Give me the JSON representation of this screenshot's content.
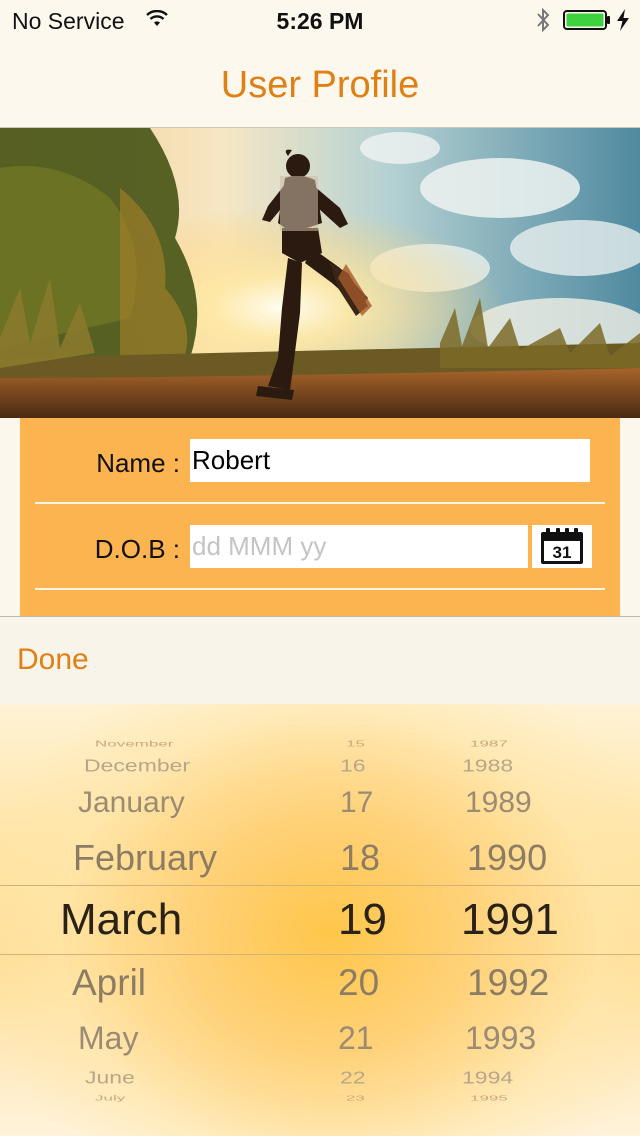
{
  "status_bar": {
    "carrier": "No Service",
    "time": "5:26 PM"
  },
  "nav": {
    "title": "User Profile"
  },
  "hero": {
    "description_icon": "runner-photo"
  },
  "form": {
    "name_label": "Name :",
    "name_value": "Robert",
    "dob_label": "D.O.B :",
    "dob_placeholder": "dd MMM yy",
    "calendar_icon_day": "31"
  },
  "toolbar": {
    "done_label": "Done"
  },
  "picker": {
    "months": [
      "November",
      "December",
      "January",
      "February",
      "March",
      "April",
      "May",
      "June",
      "July"
    ],
    "days": [
      "15",
      "16",
      "17",
      "18",
      "19",
      "20",
      "21",
      "22",
      "23"
    ],
    "years": [
      "1987",
      "1988",
      "1989",
      "1990",
      "1991",
      "1992",
      "1993",
      "1994",
      "1995"
    ],
    "selected": {
      "month": "March",
      "day": "19",
      "year": "1991"
    }
  },
  "colors": {
    "accent": "#e07f14",
    "form_panel": "#fbb44f",
    "background": "#fbf7ec"
  }
}
